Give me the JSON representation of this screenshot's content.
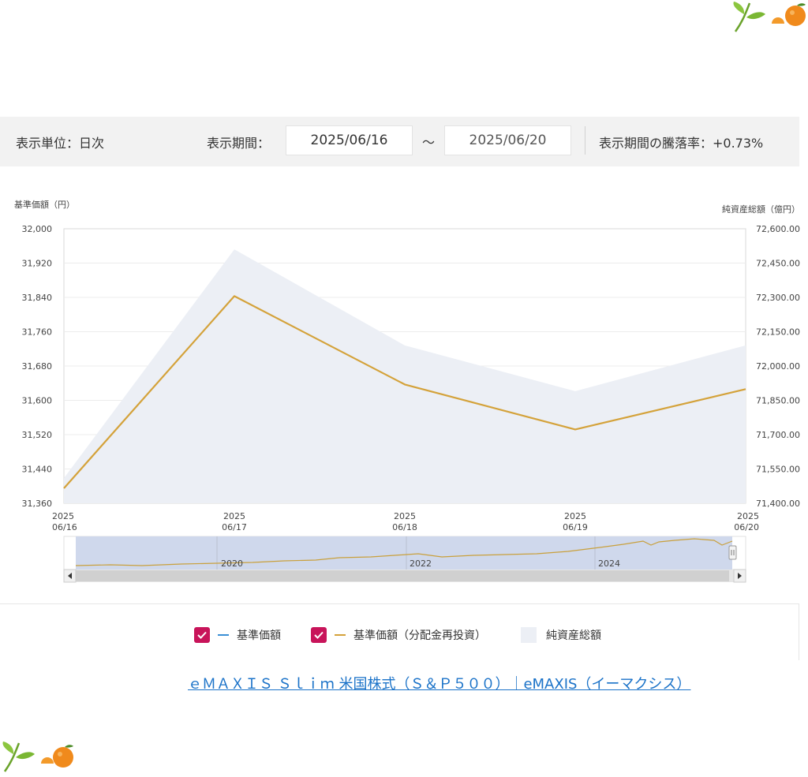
{
  "toolbar": {
    "unit_label": "表示単位：日次",
    "period_label": "表示期間：",
    "date_start": "2025/06/16",
    "date_separator": "～",
    "date_end": "2025/06/20",
    "change_label": "表示期間の騰落率：+0.73%"
  },
  "colors": {
    "nav_line": "#d4a23a",
    "nav_plain_line": "#3a8fd6",
    "assets_area": "#eceff5",
    "checkbox": "#c8145a",
    "link": "#1a72c8"
  },
  "chart_data": {
    "type": "line",
    "ylabel_left": "基準価額（円）",
    "ylabel_right": "純資産総額（億円）",
    "x": [
      "2025/06/16",
      "2025/06/17",
      "2025/06/18",
      "2025/06/19",
      "2025/06/20"
    ],
    "x_tick_labels": [
      {
        "year": "2025",
        "date": "06/16"
      },
      {
        "year": "2025",
        "date": "06/17"
      },
      {
        "year": "2025",
        "date": "06/18"
      },
      {
        "year": "2025",
        "date": "06/19"
      },
      {
        "year": "2025",
        "date": "06/20"
      }
    ],
    "y_left_ticks": [
      "32,000",
      "31,920",
      "31,840",
      "31,760",
      "31,680",
      "31,600",
      "31,520",
      "31,440",
      "31,360"
    ],
    "y_right_ticks": [
      "72,600.00",
      "72,450.00",
      "72,300.00",
      "72,150.00",
      "72,000.00",
      "71,850.00",
      "71,700.00",
      "71,550.00",
      "71,400.00"
    ],
    "ylim_left": [
      31360,
      32000
    ],
    "ylim_right": [
      71400,
      72600
    ],
    "series": [
      {
        "name": "基準価額（分配金再投資）",
        "axis": "left",
        "kind": "line",
        "values": [
          31395,
          31843,
          31637,
          31532,
          31626
        ]
      },
      {
        "name": "純資産総額",
        "axis": "right",
        "kind": "area",
        "values": [
          71510,
          72510,
          72090,
          71890,
          72090
        ]
      }
    ],
    "grid": true,
    "legend_position": "bottom",
    "navigator": {
      "labels": [
        "2020",
        "2022",
        "2024"
      ]
    }
  },
  "legend": {
    "items": [
      {
        "label": "基準価額"
      },
      {
        "label": "基準価額（分配金再投資）"
      },
      {
        "label": "純資産総額"
      }
    ]
  },
  "link": {
    "text": "ｅＭＡＸＩＳ Ｓｌｉｍ 米国株式（Ｓ＆Ｐ５００）｜eMAXIS（イーマクシス）"
  }
}
